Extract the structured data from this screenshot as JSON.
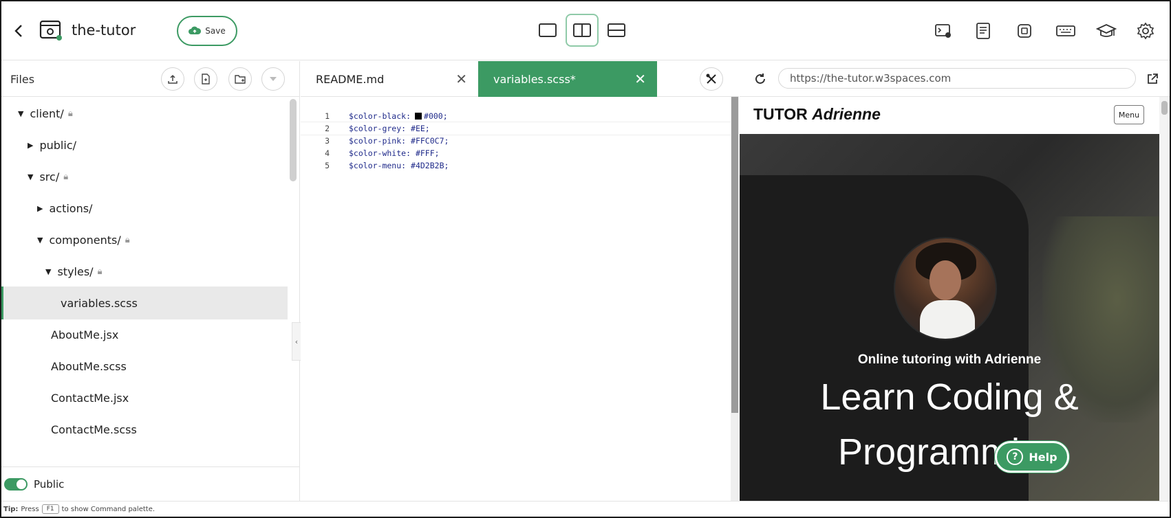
{
  "header": {
    "project_name": "the-tutor",
    "save_label": "Save",
    "layout_modes": [
      "single",
      "split-vertical",
      "split-horizontal"
    ],
    "active_layout": "split-vertical"
  },
  "files": {
    "title": "Files",
    "tree": [
      {
        "label": "client/",
        "type": "folder",
        "expanded": true,
        "locked": true
      },
      {
        "label": "public/",
        "type": "folder",
        "expanded": false,
        "locked": false
      },
      {
        "label": "src/",
        "type": "folder",
        "expanded": true,
        "locked": true
      },
      {
        "label": "actions/",
        "type": "folder",
        "expanded": false,
        "locked": false
      },
      {
        "label": "components/",
        "type": "folder",
        "expanded": true,
        "locked": true
      },
      {
        "label": "styles/",
        "type": "folder",
        "expanded": true,
        "locked": true
      },
      {
        "label": "variables.scss",
        "type": "file",
        "selected": true
      },
      {
        "label": "AboutMe.jsx",
        "type": "file"
      },
      {
        "label": "AboutMe.scss",
        "type": "file"
      },
      {
        "label": "ContactMe.jsx",
        "type": "file"
      },
      {
        "label": "ContactMe.scss",
        "type": "file"
      }
    ],
    "public_label": "Public"
  },
  "editor": {
    "tabs": [
      {
        "label": "README.md",
        "active": false
      },
      {
        "label": "variables.scss*",
        "active": true
      }
    ],
    "lines": [
      {
        "n": "1",
        "name": "$color-black:",
        "value": "#000;",
        "swatch": "#000000"
      },
      {
        "n": "2",
        "name": "$color-grey:",
        "value": "#EE;"
      },
      {
        "n": "3",
        "name": "$color-pink:",
        "value": "#FFC0C7;"
      },
      {
        "n": "4",
        "name": "$color-white:",
        "value": "#FFF;"
      },
      {
        "n": "5",
        "name": "$color-menu:",
        "value": "#4D2B2B;"
      }
    ]
  },
  "preview": {
    "url": "https://the-tutor.w3spaces.com",
    "brand_plain": "TUTOR",
    "brand_italic": "Adrienne",
    "menu_label": "Menu",
    "tagline": "Online tutoring with Adrienne",
    "headline_line1": "Learn Coding &",
    "headline_line2": "Programming"
  },
  "help_label": "Help",
  "tip": {
    "prefix": "Tip:",
    "press": "Press",
    "key": "F1",
    "suffix": "to show Command palette."
  },
  "colors": {
    "accent": "#3c9a63",
    "code_text": "#1f2a8a"
  }
}
